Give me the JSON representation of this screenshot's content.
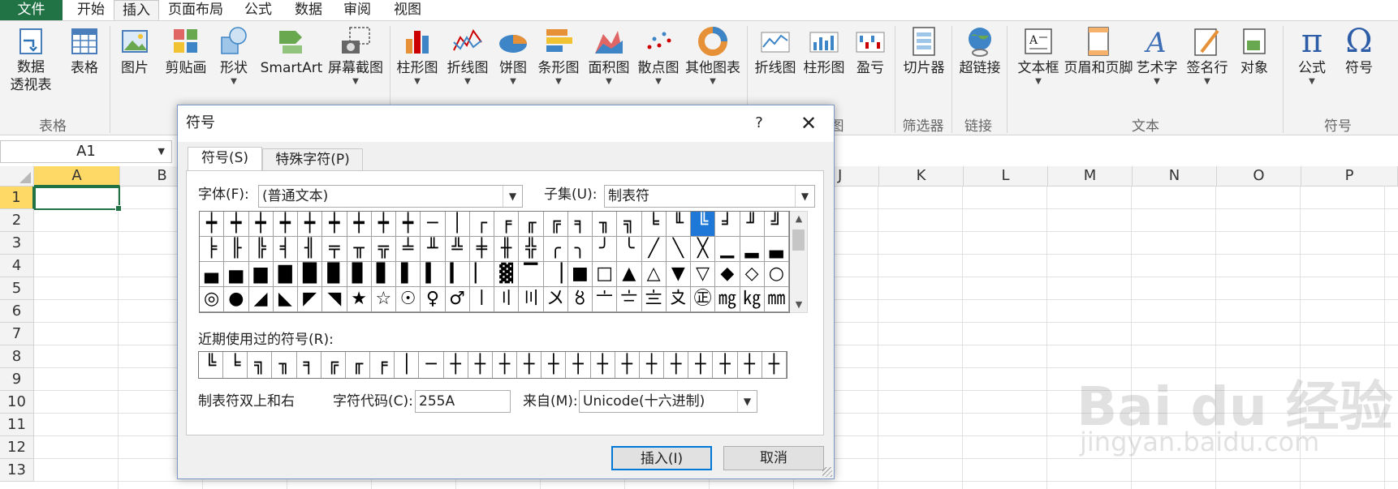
{
  "tabs": [
    "文件",
    "开始",
    "插入",
    "页面布局",
    "公式",
    "数据",
    "审阅",
    "视图"
  ],
  "active_tab": "插入",
  "ribbon": {
    "buttons": {
      "pivot_table": "数据\n透视表",
      "table": "表格",
      "picture": "图片",
      "clipart": "剪贴画",
      "shapes": "形状",
      "smartart": "SmartArt",
      "screenshot": "屏幕截图",
      "bar_chart": "柱形图",
      "line_chart": "折线图",
      "pie_chart": "饼图",
      "hbar_chart": "条形图",
      "area_chart": "面积图",
      "scatter_chart": "散点图",
      "other_chart": "其他图表",
      "spark_line": "折线图",
      "spark_column": "柱形图",
      "spark_winloss": "盈亏",
      "slicer": "切片器",
      "hyperlink": "超链接",
      "textbox": "文本框",
      "header_footer": "页眉和页脚",
      "wordart": "艺术字",
      "signature": "签名行",
      "object": "对象",
      "equation": "公式",
      "symbol": "符号"
    },
    "groups": {
      "tables": "表格",
      "charts_tail": "图",
      "filter": "筛选器",
      "links": "链接",
      "text": "文本",
      "symbols": "符号"
    },
    "equation_glyph": "π",
    "symbol_glyph": "Ω"
  },
  "name_box": "A1",
  "columns": [
    "A",
    "B",
    "J",
    "K",
    "L",
    "M",
    "N",
    "O",
    "P"
  ],
  "rows": [
    "1",
    "2",
    "3",
    "4",
    "5",
    "6",
    "7",
    "8",
    "9",
    "10",
    "11",
    "12",
    "13"
  ],
  "dialog": {
    "title": "符号",
    "help": "?",
    "close": "✕",
    "tab_symbols": "符号(S)",
    "tab_special": "特殊字符(P)",
    "font_label": "字体(F):",
    "font_value": "(普通文本)",
    "subset_label": "子集(U):",
    "subset_value": "制表符",
    "symbols": [
      "┿",
      "┿",
      "┿",
      "┿",
      "┿",
      "┿",
      "┿",
      "┿",
      "┿",
      "─",
      "│",
      "┌",
      "╒",
      "╓",
      "╔",
      "╕",
      "╖",
      "╗",
      "╘",
      "╙",
      "╚",
      "╛",
      "╜",
      "╝",
      "╞",
      "╟",
      "╠",
      "╡",
      "╢",
      "╤",
      "╥",
      "╦",
      "╧",
      "╨",
      "╩",
      "╪",
      "╫",
      "╬",
      "╭",
      "╮",
      "╯",
      "╰",
      "╱",
      "╲",
      "╳",
      "▁",
      "▂",
      "▃",
      "▄",
      "▅",
      "▆",
      "▇",
      "█",
      "▉",
      "▊",
      "▋",
      "▌",
      "▍",
      "▎",
      "▏",
      "▓",
      "▔",
      "▕",
      "■",
      "□",
      "▲",
      "△",
      "▼",
      "▽",
      "◆",
      "◇",
      "○",
      "◎",
      "●",
      "◢",
      "◣",
      "◤",
      "◥",
      "★",
      "☆",
      "☉",
      "♀",
      "♂",
      "〡",
      "〢",
      "〣",
      "〤",
      "〥",
      "〦",
      "〧",
      "〨",
      "〩",
      "㊣",
      "㎎",
      "㎏",
      "㎜"
    ],
    "selected_symbol_index": 20,
    "recent_label": "近期使用过的符号(R):",
    "recent": [
      "╚",
      "╘",
      "╗",
      "╖",
      "╕",
      "╔",
      "╓",
      "╒",
      "│",
      "─",
      "┼",
      "┼",
      "┼",
      "┼",
      "┼",
      "┼",
      "┼",
      "┼",
      "┼",
      "┼",
      "┼",
      "┼",
      "┼",
      "┼"
    ],
    "char_name": "制表符双上和右",
    "code_label": "字符代码(C):",
    "code_value": "255A",
    "from_label": "来自(M):",
    "from_value": "Unicode(十六进制)",
    "insert_button": "插入(I)",
    "cancel_button": "取消"
  },
  "watermark": {
    "brand": "Bai du 经验",
    "url": "jingyan.baidu.com"
  }
}
